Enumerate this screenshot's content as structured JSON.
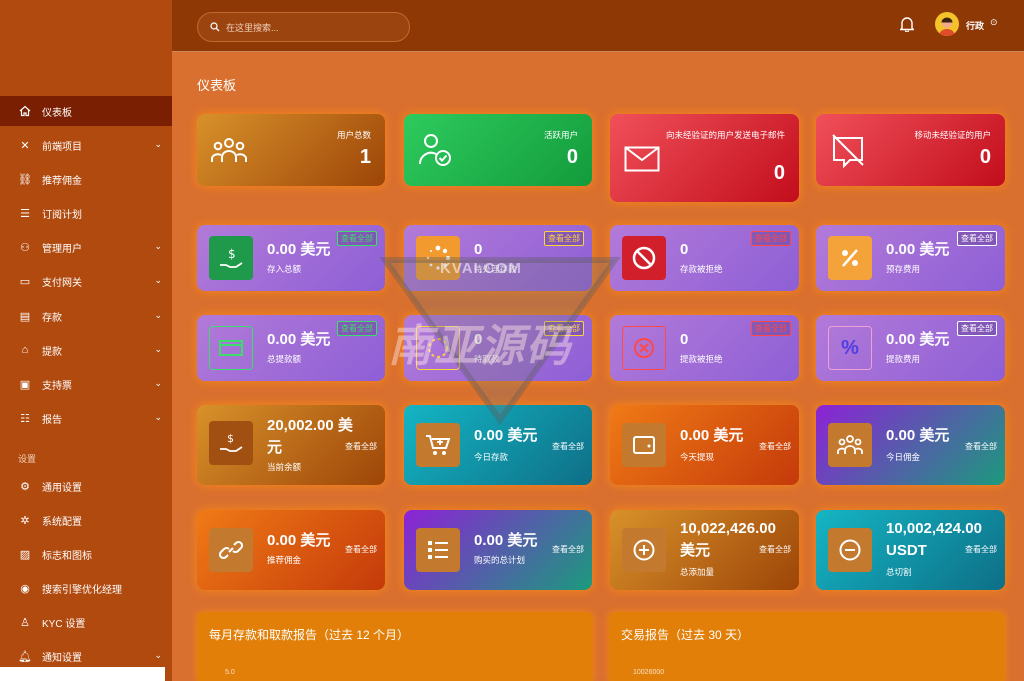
{
  "search": {
    "placeholder": "在这里搜索..."
  },
  "user": {
    "name": "行政"
  },
  "page_title": "仪表板",
  "sidebar": {
    "items": [
      {
        "label": "仪表板",
        "icon": "home-icon"
      },
      {
        "label": "前端项目",
        "icon": "tools-icon"
      },
      {
        "label": "推荐佣金",
        "icon": "link-icon"
      },
      {
        "label": "订阅计划",
        "icon": "list-icon"
      },
      {
        "label": "管理用户",
        "icon": "users-icon"
      },
      {
        "label": "支付网关",
        "icon": "card-icon"
      },
      {
        "label": "存款",
        "icon": "deposit-icon"
      },
      {
        "label": "提款",
        "icon": "bank-icon"
      },
      {
        "label": "支持票",
        "icon": "ticket-icon"
      },
      {
        "label": "报告",
        "icon": "report-icon"
      }
    ],
    "section": "设置",
    "settings": [
      {
        "label": "通用设置",
        "icon": "gear-icon"
      },
      {
        "label": "系统配置",
        "icon": "cog-icon"
      },
      {
        "label": "标志和图标",
        "icon": "image-icon"
      },
      {
        "label": "搜索引擎优化经理",
        "icon": "seo-icon"
      },
      {
        "label": "KYC 设置",
        "icon": "user-check-icon"
      },
      {
        "label": "通知设置",
        "icon": "bell-icon"
      }
    ]
  },
  "stats": [
    {
      "title": "用户总数",
      "value": "1"
    },
    {
      "title": "活跃用户",
      "value": "0"
    },
    {
      "title": "向未经验证的用户发送电子邮件",
      "value": "0"
    },
    {
      "title": "移动未经验证的用户",
      "value": "0"
    }
  ],
  "view_all": "查看全部",
  "row2": [
    {
      "amount": "0.00 美元",
      "label": "存入总额"
    },
    {
      "amount": "0",
      "label": "待处理存款"
    },
    {
      "amount": "0",
      "label": "存款被拒绝"
    },
    {
      "amount": "0.00 美元",
      "label": "预存费用"
    }
  ],
  "row3": [
    {
      "amount": "0.00 美元",
      "label": "总提款额"
    },
    {
      "amount": "0",
      "label": "待取款"
    },
    {
      "amount": "0",
      "label": "提款被拒绝"
    },
    {
      "amount": "0.00 美元",
      "label": "提款费用"
    }
  ],
  "row4": [
    {
      "amount": "20,002.00 美元",
      "label": "当前余额"
    },
    {
      "amount": "0.00 美元",
      "label": "今日存款"
    },
    {
      "amount": "0.00 美元",
      "label": "今天提现"
    },
    {
      "amount": "0.00 美元",
      "label": "今日佣金"
    }
  ],
  "row5": [
    {
      "amount": "0.00 美元",
      "label": "推荐佣金"
    },
    {
      "amount": "0.00 美元",
      "label": "购买的总计划"
    },
    {
      "amount": "10,022,426.00 美元",
      "label": "总添加量"
    },
    {
      "amount": "10,002,424.00 USDT",
      "label": "总切割"
    }
  ],
  "panels": [
    {
      "title": "每月存款和取款报告（过去 12 个月）",
      "axis": "5.0"
    },
    {
      "title": "交易报告（过去 30 天）",
      "axis": "10026000"
    }
  ],
  "watermark": {
    "line1": "KVAI.COM",
    "line2": "南亚源码"
  },
  "colors": {
    "accent": "#d9702f",
    "sidebar": "#b14a0f",
    "topbar": "#8e3806"
  }
}
